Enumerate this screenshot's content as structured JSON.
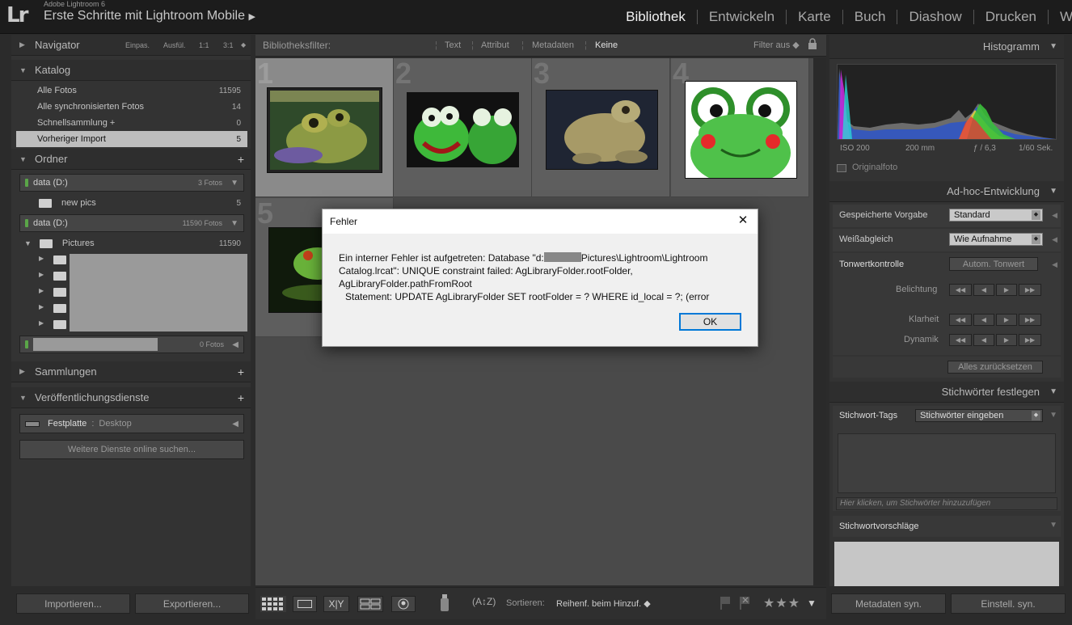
{
  "app": {
    "name": "Adobe Lightroom 6",
    "catalog": "Erste Schritte mit Lightroom Mobile"
  },
  "modules": [
    "Bibliothek",
    "Entwickeln",
    "Karte",
    "Buch",
    "Diashow",
    "Drucken",
    "Web"
  ],
  "active_module": "Bibliothek",
  "navigator": {
    "title": "Navigator",
    "options": [
      "Einpas.",
      "Ausfül.",
      "1:1",
      "3:1"
    ]
  },
  "katalog": {
    "title": "Katalog",
    "items": [
      {
        "label": "Alle Fotos",
        "count": "11595"
      },
      {
        "label": "Alle synchronisierten Fotos",
        "count": "14"
      },
      {
        "label": "Schnellsammlung +",
        "count": "0"
      },
      {
        "label": "Vorheriger Import",
        "count": "5"
      }
    ]
  },
  "ordner": {
    "title": "Ordner",
    "volumes": [
      {
        "label": "data (D:)",
        "info": "3 Fotos"
      },
      {
        "label": "data (D:)",
        "info": "11590 Fotos"
      },
      {
        "label": "",
        "info": "0 Fotos"
      }
    ],
    "new_pics": {
      "label": "new pics",
      "count": "5"
    },
    "pictures": {
      "label": "Pictures",
      "count": "11590"
    }
  },
  "sammlungen": {
    "title": "Sammlungen"
  },
  "publish": {
    "title": "Veröffentlichungsdienste",
    "service_name": "Festplatte",
    "service_sep": ":",
    "service_target": "Desktop",
    "more_button": "Weitere Dienste online suchen..."
  },
  "left_buttons": {
    "import": "Importieren...",
    "export": "Exportieren..."
  },
  "filterbar": {
    "label": "Bibliotheksfilter:",
    "options": [
      "Text",
      "Attribut",
      "Metadaten",
      "Keine"
    ],
    "right": "Filter aus ◆"
  },
  "grid": {
    "cells": [
      "1",
      "2",
      "3",
      "4",
      "5"
    ]
  },
  "toolbar": {
    "sort_label": "Sortieren:",
    "sort_value": "Reihenf. beim Hinzuf. ◆"
  },
  "histogram": {
    "title": "Histogramm",
    "iso": "ISO 200",
    "focal": "200 mm",
    "aperture": "ƒ / 6,3",
    "shutter": "1/60 Sek.",
    "original": "Originalfoto"
  },
  "quick_develop": {
    "title": "Ad-hoc-Entwicklung",
    "preset_label": "Gespeicherte Vorgabe",
    "preset_value": "Standard",
    "wb_label": "Weißabgleich",
    "wb_value": "Wie Aufnahme",
    "tone_label": "Tonwertkontrolle",
    "auto_tone": "Autom. Tonwert",
    "exposure": "Belichtung",
    "clarity": "Klarheit",
    "vibrance": "Dynamik",
    "reset": "Alles zurücksetzen"
  },
  "keywording": {
    "title": "Stichwörter festlegen",
    "tags_label": "Stichwort-Tags",
    "tags_value": "Stichwörter eingeben",
    "hint": "Hier klicken, um Stichwörter hinzuzufügen",
    "suggestions": "Stichwortvorschläge"
  },
  "right_buttons": {
    "sync_meta": "Metadaten syn.",
    "sync_settings": "Einstell. syn."
  },
  "dialog": {
    "title": "Fehler",
    "line1_prefix": "Ein interner Fehler ist aufgetreten: Database \"d:",
    "line1_suffix": "Pictures\\Lightroom\\Lightroom",
    "line2": "Catalog.lrcat\": UNIQUE constraint failed: AgLibraryFolder.rootFolder,",
    "line3": "AgLibraryFolder.pathFromRoot",
    "line4": "Statement: UPDATE AgLibraryFolder SET rootFolder = ? WHERE id_local = ?; (error",
    "ok": "OK"
  }
}
